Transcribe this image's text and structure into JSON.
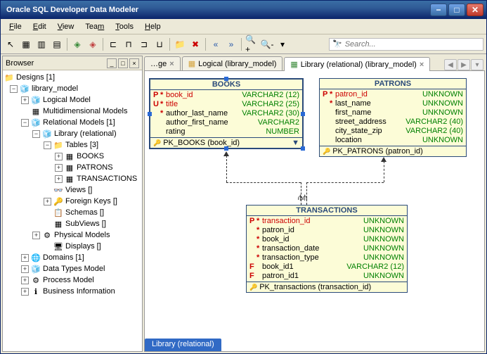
{
  "window": {
    "title": "Oracle SQL Developer Data Modeler"
  },
  "menu": {
    "file": "File",
    "edit": "Edit",
    "view": "View",
    "team": "Team",
    "tools": "Tools",
    "help": "Help"
  },
  "search": {
    "placeholder": "Search..."
  },
  "browser": {
    "title": "Browser",
    "root": "Designs [1]",
    "model": "library_model",
    "logical": "Logical Model",
    "multidim": "Multidimensional Models",
    "relational": "Relational Models [1]",
    "library": "Library (relational)",
    "tables": "Tables [3]",
    "books": "BOOKS",
    "patrons": "PATRONS",
    "transact": "TRANSACTIONS",
    "views": "Views []",
    "fks": "Foreign Keys []",
    "schemas": "Schemas []",
    "subviews": "SubViews []",
    "physical": "Physical Models",
    "displays": "Displays []",
    "domains": "Domains [1]",
    "datatypes": "Data Types Model",
    "process": "Process Model",
    "business": "Business Information"
  },
  "tabs": {
    "t1": "…ge",
    "t2": "Logical (library_model)",
    "t3": "Library (relational) (library_model)"
  },
  "status_tab": "Library (relational)",
  "entities": {
    "books": {
      "title": "BOOKS",
      "pk": "PK_BOOKS (book_id)",
      "cols": [
        {
          "m": "P",
          "s": "*",
          "n": "book_id",
          "t": "VARCHAR2 (12)",
          "key": true
        },
        {
          "m": "U",
          "s": "*",
          "n": "title",
          "t": "VARCHAR2 (25)",
          "key": true
        },
        {
          "m": "",
          "s": "*",
          "n": "author_last_name",
          "t": "VARCHAR2 (30)"
        },
        {
          "m": "",
          "s": "",
          "n": "author_first_name",
          "t": "VARCHAR2"
        },
        {
          "m": "",
          "s": "",
          "n": "rating",
          "t": "NUMBER"
        }
      ]
    },
    "patrons": {
      "title": "PATRONS",
      "pk": "PK_PATRONS (patron_id)",
      "cols": [
        {
          "m": "P",
          "s": "*",
          "n": "patron_id",
          "t": "UNKNOWN",
          "key": true
        },
        {
          "m": "",
          "s": "*",
          "n": "last_name",
          "t": "UNKNOWN"
        },
        {
          "m": "",
          "s": "",
          "n": "first_name",
          "t": "UNKNOWN"
        },
        {
          "m": "",
          "s": "",
          "n": "street_address",
          "t": "VARCHAR2 (40)"
        },
        {
          "m": "",
          "s": "",
          "n": "city_state_zip",
          "t": "VARCHAR2 (40)"
        },
        {
          "m": "",
          "s": "",
          "n": "location",
          "t": "UNKNOWN"
        }
      ]
    },
    "transactions": {
      "title": "TRANSACTIONS",
      "pk": "PK_transactions (transaction_id)",
      "cols": [
        {
          "m": "P",
          "s": "*",
          "n": "transaction_id",
          "t": "UNKNOWN",
          "key": true
        },
        {
          "m": "",
          "s": "*",
          "n": "patron_id",
          "t": "UNKNOWN"
        },
        {
          "m": "",
          "s": "*",
          "n": "book_id",
          "t": "UNKNOWN"
        },
        {
          "m": "",
          "s": "*",
          "n": "transaction_date",
          "t": "UNKNOWN"
        },
        {
          "m": "",
          "s": "*",
          "n": "transaction_type",
          "t": "UNKNOWN"
        },
        {
          "m": "F",
          "s": "",
          "n": "book_id1",
          "t": "VARCHAR2 (12)"
        },
        {
          "m": "F",
          "s": "",
          "n": "patron_id1",
          "t": "UNKNOWN"
        }
      ]
    }
  }
}
